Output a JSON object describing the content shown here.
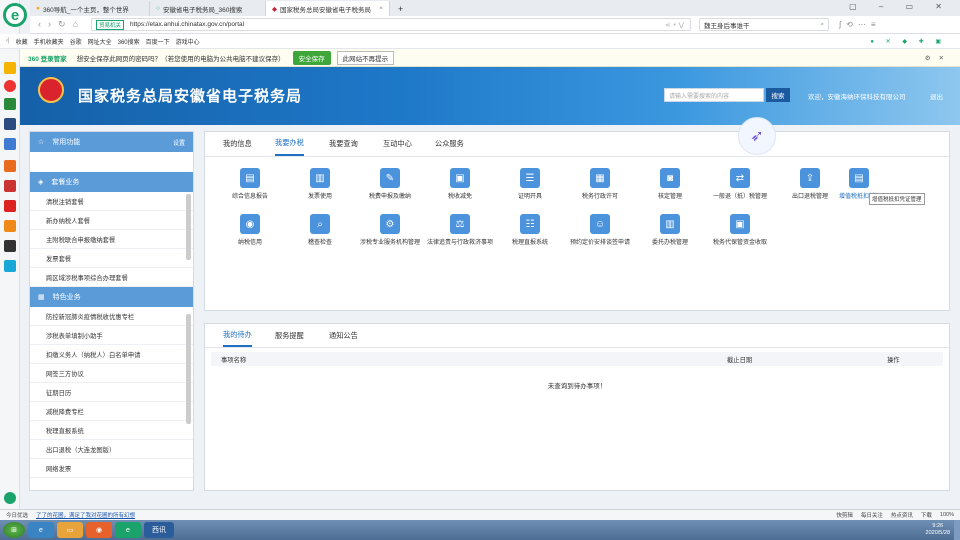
{
  "browser": {
    "tabs": [
      {
        "label": "360导航_一个主页，整个世界",
        "active": false
      },
      {
        "label": "安徽省电子税务局_360搜索",
        "active": false
      },
      {
        "label": "国家税务总局安徽省电子税务局",
        "active": true
      }
    ],
    "add_tab": "+",
    "url_secure_label": "贸易机关",
    "url": "https://etax.anhui.chinatax.gov.cn/portal",
    "search_box": "魏王身后事谁干",
    "bookmarks": [
      "收藏",
      "手机收藏夹",
      "谷歌",
      "网址大全",
      "360搜索",
      "百度一下",
      "游戏中心"
    ],
    "bar360_logo": "360 登录管家",
    "bar360_text": "想安全保存此网页的密码吗？（若您使用的电脑为公共电脑不建议保存）",
    "bar360_save": "安全保存",
    "bar360_nomore": "此网站不再提示"
  },
  "header": {
    "title": "国家税务总局安徽省电子税务局",
    "search_placeholder": "请输入需要搜索的内容",
    "search_btn": "搜索",
    "welcome": "欢迎，安徽海纳环保科技有限公司",
    "logout": "退出"
  },
  "left": {
    "common_title": "常用功能",
    "common_setting": "设置",
    "package_title": "套餐业务",
    "package_items": [
      "清税注销套餐",
      "新办纳税人套餐",
      "主附税联合申报缴纳套餐",
      "发票套餐",
      "跨区域涉税事项综合办理套餐"
    ],
    "special_title": "特色业务",
    "special_items": [
      "防控新冠肺炎疫情税收优惠专栏",
      "涉税表单填制小助手",
      "扣缴义务人（纳税人）白名单申请",
      "网签三方协议",
      "征期日历",
      "减税降费专栏",
      "税理直报系统",
      "出口退税（大连龙图版）",
      "网络发票"
    ]
  },
  "main": {
    "tabs": [
      "我的信息",
      "我要办税",
      "我要查询",
      "互动中心",
      "公众服务"
    ],
    "active_tab": "我要办税",
    "functions": [
      {
        "label": "综合信息报告",
        "icon": "report-icon"
      },
      {
        "label": "发票使用",
        "icon": "invoice-icon"
      },
      {
        "label": "税费申报及缴纳",
        "icon": "declare-icon"
      },
      {
        "label": "税收减免",
        "icon": "reduce-icon"
      },
      {
        "label": "证明开具",
        "icon": "certificate-icon"
      },
      {
        "label": "税务行政许可",
        "icon": "license-icon"
      },
      {
        "label": "核定管理",
        "icon": "verify-icon"
      },
      {
        "label": "一般退（抵）税管理",
        "icon": "refund-icon"
      },
      {
        "label": "出口退税管理",
        "icon": "export-icon"
      },
      {
        "label": "增值税抵扣凭证管理",
        "icon": "vat-icon"
      },
      {
        "label": "纳税信用",
        "icon": "credit-icon"
      },
      {
        "label": "稽查检查",
        "icon": "inspect-icon"
      },
      {
        "label": "涉税专业服务机构管理",
        "icon": "agency-icon"
      },
      {
        "label": "法律追责与行政救济事项",
        "icon": "law-icon"
      },
      {
        "label": "税理直报系统",
        "icon": "direct-icon"
      },
      {
        "label": "预约定价安排谈签申请",
        "icon": "pricing-icon"
      },
      {
        "label": "委托办税管理",
        "icon": "entrust-icon"
      },
      {
        "label": "税务代保管资金收取",
        "icon": "custody-icon"
      }
    ],
    "tooltip": "增值税抵扣凭证管理"
  },
  "todo": {
    "tabs": [
      "我的待办",
      "服务提醒",
      "通知公告"
    ],
    "col_name": "事项名称",
    "col_deadline": "截止日期",
    "col_action": "操作",
    "empty": "未查询到待办事项！"
  },
  "status": {
    "left": "今日优选",
    "news": "了了的花圃，满足了我对花圃的所有幻想",
    "right": [
      "快剪辑",
      "每日关注",
      "热点资讯",
      "下载"
    ],
    "zoom": "100%"
  },
  "taskbar": {
    "time": "9:26",
    "date": "2020/5/28",
    "app_label": "西讯"
  },
  "colors": {
    "brand": "#1f6fc2",
    "header": "#1e78c8",
    "save_btn": "#3ea63b"
  }
}
